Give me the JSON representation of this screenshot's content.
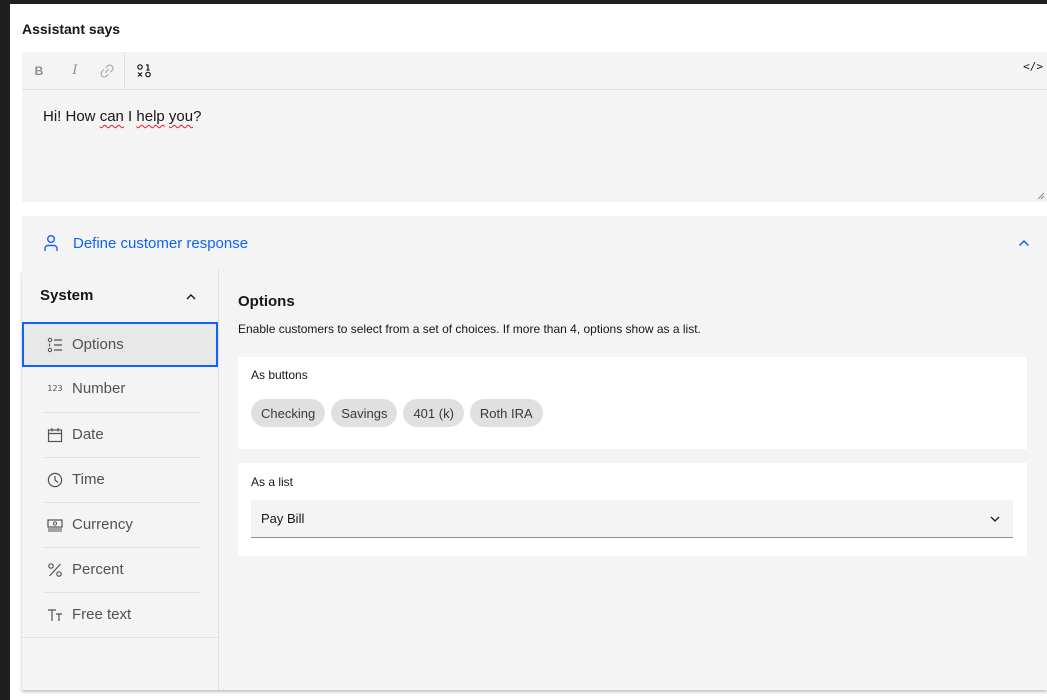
{
  "assistant": {
    "title": "Assistant says",
    "toolbar": {
      "bold": "B",
      "italic": "I",
      "code": "</>"
    },
    "message_parts": [
      "Hi! How ",
      "can",
      " I ",
      "help",
      " ",
      "you",
      "?"
    ]
  },
  "customer_response": {
    "label": "Define customer response"
  },
  "sidebar": {
    "heading": "System",
    "items": [
      {
        "label": "Options",
        "icon": "options-list-icon",
        "active": true
      },
      {
        "label": "Number",
        "icon": "number-icon"
      },
      {
        "label": "Date",
        "icon": "calendar-icon"
      },
      {
        "label": "Time",
        "icon": "clock-icon"
      },
      {
        "label": "Currency",
        "icon": "currency-icon"
      },
      {
        "label": "Percent",
        "icon": "percent-icon"
      },
      {
        "label": "Free text",
        "icon": "text-icon"
      }
    ]
  },
  "options": {
    "title": "Options",
    "description": "Enable customers to select from a set of choices. If more than 4, options show as a list.",
    "buttons_label": "As buttons",
    "chips": [
      "Checking",
      "Savings",
      "401 (k)",
      "Roth IRA"
    ],
    "list_label": "As a list",
    "list_value": "Pay Bill"
  },
  "colors": {
    "accent": "#0f62fe",
    "panel": "#f4f4f4",
    "chip": "#e0e0e0"
  }
}
